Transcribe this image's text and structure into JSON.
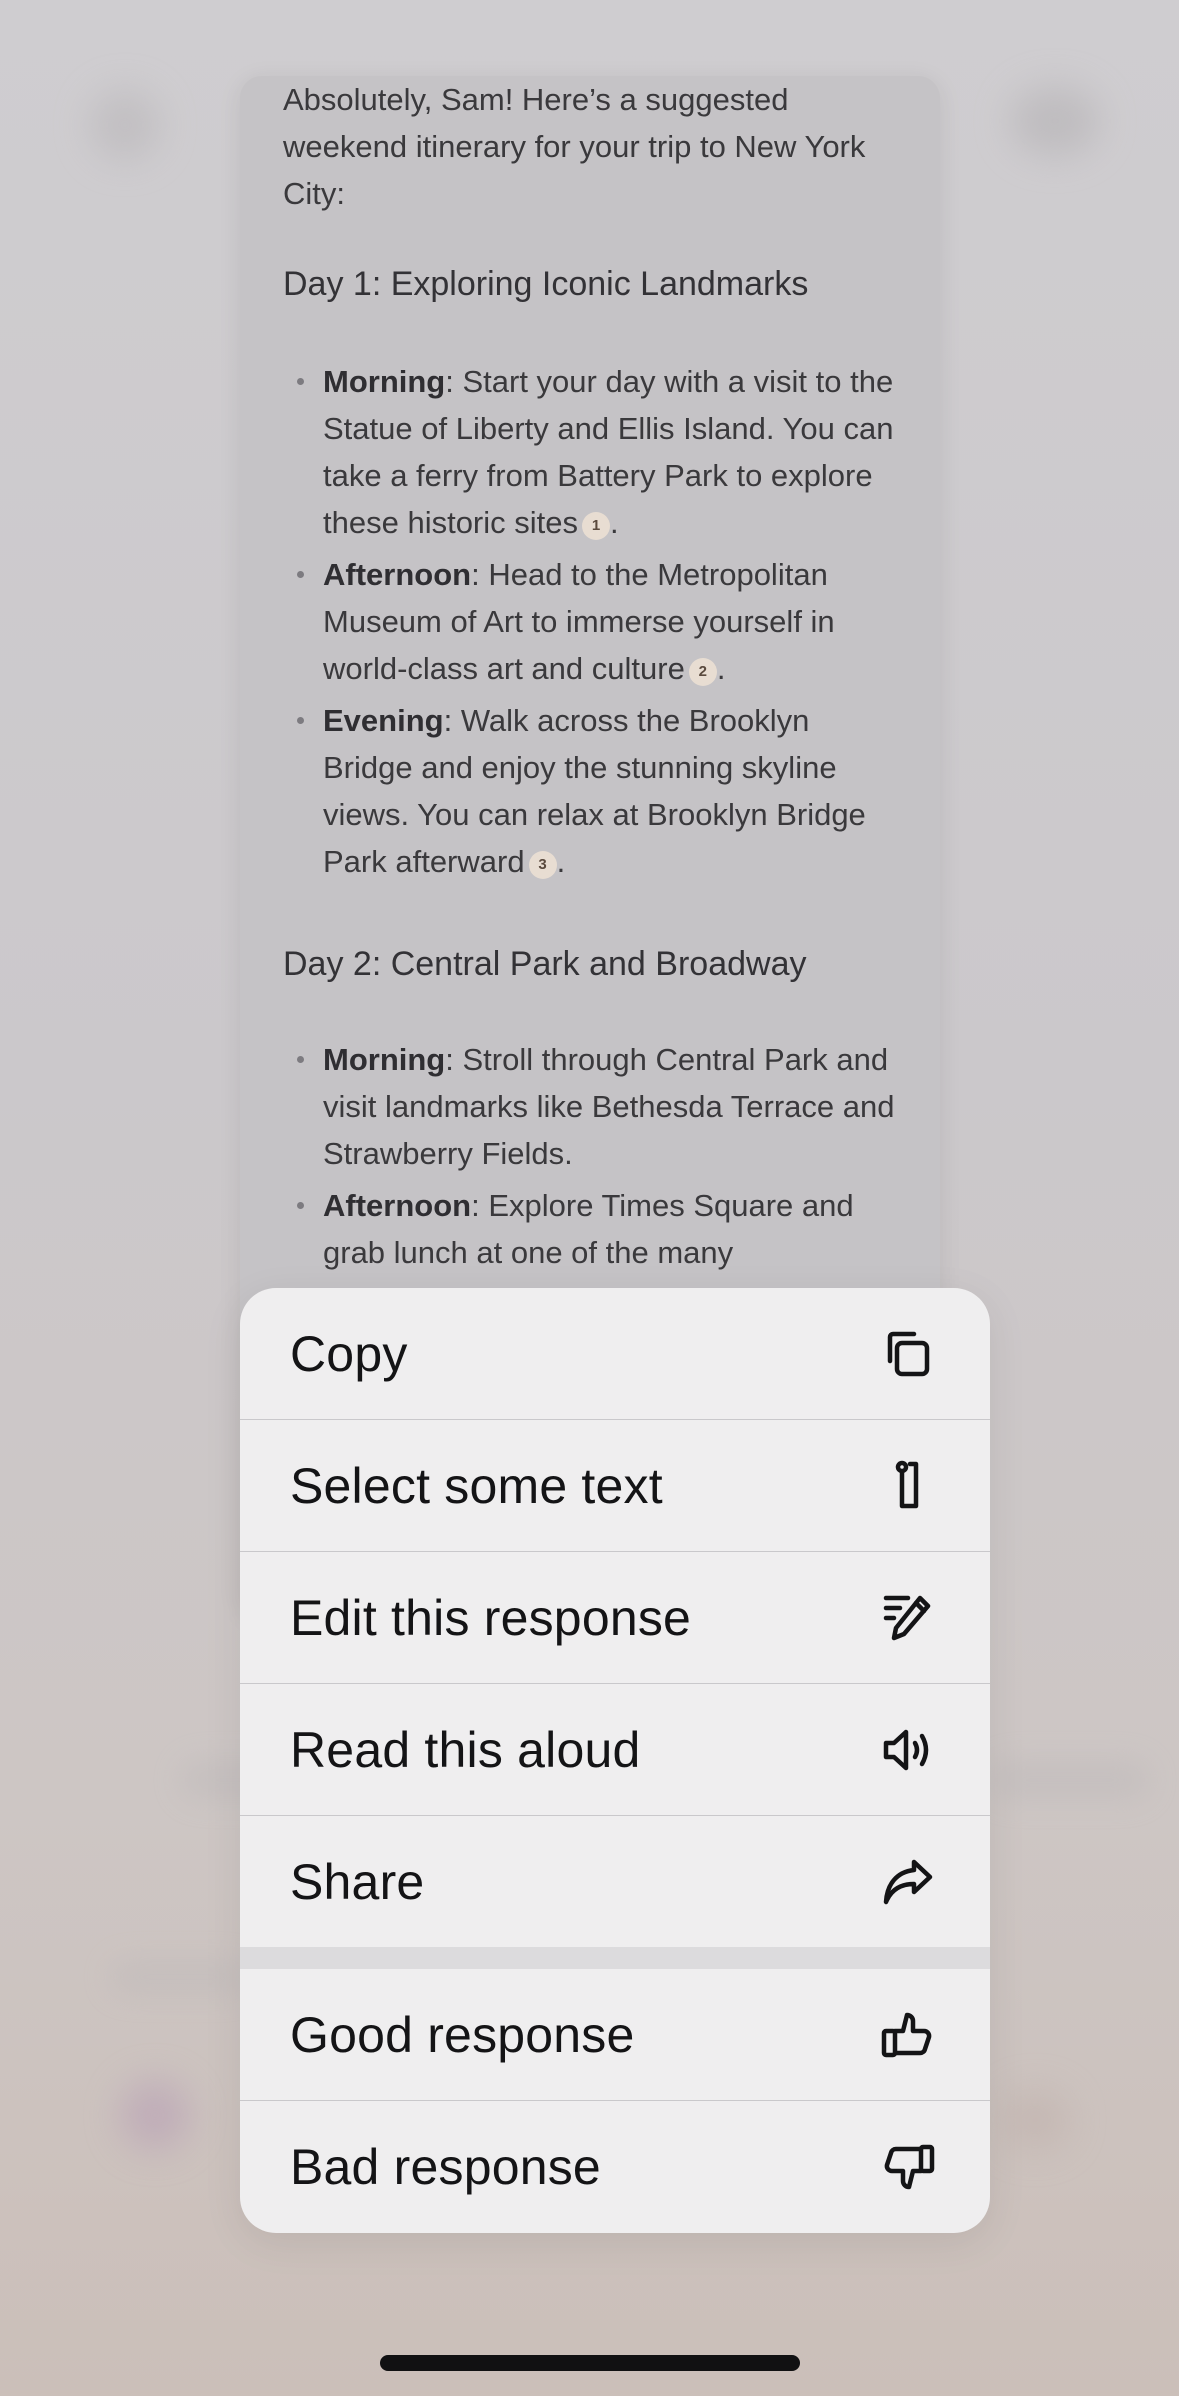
{
  "message": {
    "intro": "Absolutely, Sam! Here’s a suggested weekend itinerary for your trip to New York City:",
    "day1": {
      "heading": "Day 1: Exploring Iconic Landmarks",
      "items": [
        {
          "label": "Morning",
          "text": ": Start your day with a visit to the Statue of Liberty and Ellis Island. You can take a ferry from Battery Park to explore these historic sites",
          "cite": "1",
          "end": "."
        },
        {
          "label": "Afternoon",
          "text": ": Head to the Metropolitan Museum of Art to immerse yourself in world-class art and culture",
          "cite": "2",
          "end": "."
        },
        {
          "label": "Evening",
          "text": ": Walk across the Brooklyn Bridge and enjoy the stunning skyline views. You can relax at Brooklyn Bridge Park afterward",
          "cite": "3",
          "end": "."
        }
      ]
    },
    "day2": {
      "heading": "Day 2: Central Park and Broadway",
      "items": [
        {
          "label": "Morning",
          "text": ": Stroll through Central Park and visit landmarks like Bethesda Terrace and Strawberry Fields."
        },
        {
          "label": "Afternoon",
          "text": ": Explore Times Square and grab lunch at one of the many"
        }
      ]
    }
  },
  "menu": {
    "items": [
      {
        "label": "Copy",
        "icon": "copy-icon"
      },
      {
        "label": "Select some text",
        "icon": "select-text-icon"
      },
      {
        "label": "Edit this response",
        "icon": "edit-icon"
      },
      {
        "label": "Read this aloud",
        "icon": "speaker-icon"
      },
      {
        "label": "Share",
        "icon": "share-icon"
      },
      {
        "label": "Good response",
        "icon": "thumbs-up-icon"
      },
      {
        "label": "Bad response",
        "icon": "thumbs-down-icon"
      }
    ]
  }
}
